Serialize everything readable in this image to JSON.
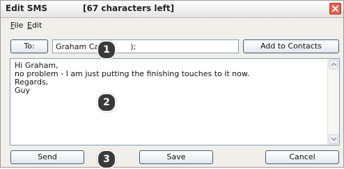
{
  "window": {
    "title": "Edit SMS",
    "chars_left": "[67 characters left]"
  },
  "menu": {
    "file": "File",
    "edit": "Edit"
  },
  "recipient": {
    "to_label": "To:",
    "value": "Graham Cau",
    "value_tail": ");"
  },
  "add_contacts_label": "Add to Contacts",
  "message": {
    "lines": [
      "Hi Graham,",
      "no problem - I am just putting the finishing touches to it now.",
      "Regards,",
      "Guy"
    ]
  },
  "buttons": {
    "send": "Send",
    "save": "Save",
    "cancel": "Cancel"
  },
  "callouts": [
    "1",
    "2",
    "3"
  ]
}
